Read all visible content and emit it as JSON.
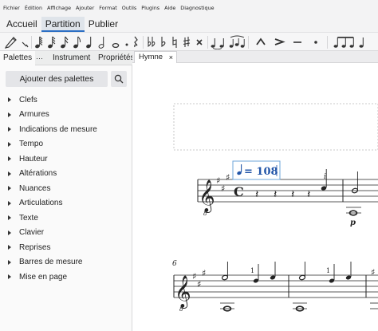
{
  "menubar": {
    "items": [
      "Fichier",
      "Édition",
      "Affichage",
      "Ajouter",
      "Format",
      "Outils",
      "Plugins",
      "Aide",
      "Diagnostique"
    ]
  },
  "workspace_tabs": {
    "items": [
      "Accueil",
      "Partition",
      "Publier"
    ],
    "active": "Partition"
  },
  "toolbar": {
    "icons": [
      "default-mode-icon",
      "pen-input-icon",
      "sixty-fourth-note-icon",
      "thirty-second-note-icon",
      "sixteenth-note-icon",
      "eighth-note-icon",
      "quarter-note-icon",
      "half-note-icon",
      "whole-note-icon",
      "augmentation-dot-icon",
      "rest-icon",
      "double-flat-icon",
      "flat-icon",
      "natural-icon",
      "sharp-icon",
      "double-sharp-icon",
      "tie-icon",
      "slur-icon",
      "marcato-icon",
      "accent-icon",
      "tenuto-icon",
      "staccato-icon",
      "tuplet-icon"
    ]
  },
  "panel_tabs": {
    "items": [
      "Palettes",
      "Instrument",
      "Propriétés"
    ],
    "active": "Palettes",
    "more": "···"
  },
  "palettes": {
    "add_label": "Ajouter des palettes",
    "items": [
      "Clefs",
      "Armures",
      "Indications de mesure",
      "Tempo",
      "Hauteur",
      "Altérations",
      "Nuances",
      "Articulations",
      "Texte",
      "Clavier",
      "Reprises",
      "Barres de mesure",
      "Mise en page"
    ]
  },
  "score_tab": {
    "label": "Hymne",
    "close": "×"
  },
  "score": {
    "tempo_text": "= 108",
    "time_signature": "C",
    "key": "A major (3 sharps)",
    "clef": "treble-8vb",
    "fingering_i": "i",
    "dynamic": "p",
    "measure_number": "6",
    "fingering_1": "1",
    "colors": {
      "tempo": "#2255a8",
      "selection": "#6da4d8"
    }
  }
}
